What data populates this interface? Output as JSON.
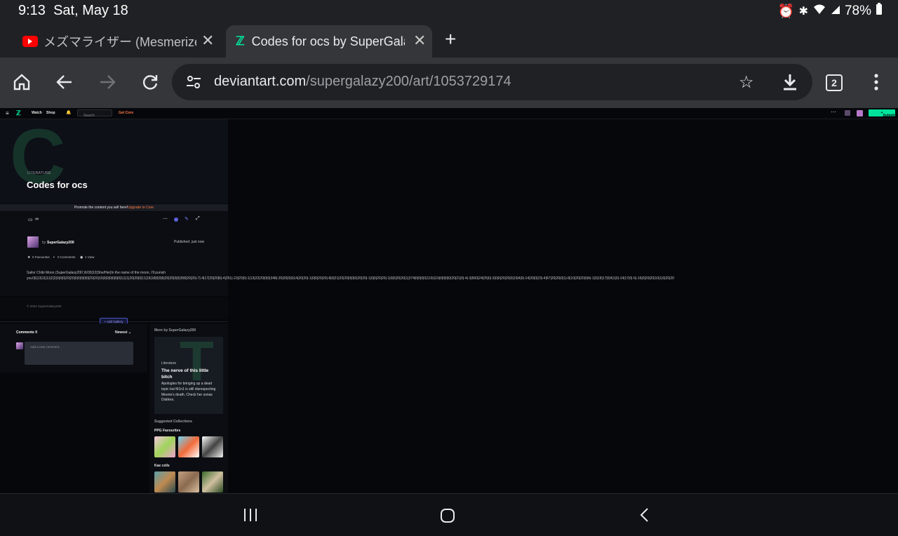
{
  "status_bar": {
    "time": "9:13",
    "date": "Sat, May 18",
    "battery": "78%",
    "icons": [
      "alarm-icon",
      "bluetooth-icon",
      "wifi-icon",
      "signal-icon",
      "battery-icon"
    ]
  },
  "tabs": [
    {
      "title": "メズマライザー (Mesmerizer)",
      "icon": "youtube-icon",
      "active": false
    },
    {
      "title": "Codes for ocs by SuperGalazy",
      "icon": "deviantart-icon",
      "active": true
    }
  ],
  "toolbar": {
    "url_host": "deviantart.com",
    "url_path": "/supergalazy200/art/1053729174",
    "tab_count": "2"
  },
  "colors": {
    "accent_green": "#00e59b",
    "core_orange": "#ff7a45"
  },
  "da": {
    "nav": {
      "watch": "Watch",
      "shop": "Shop",
      "search_placeholder": "Search",
      "get_core": "Get Core",
      "submit": "Submit"
    },
    "hero": {
      "category": "LITERATURE",
      "title": "Codes for ocs"
    },
    "promo": {
      "text": "Promote the content you sell here!",
      "link": "Upgrade to Core"
    },
    "author": {
      "by": "by",
      "name": "SuperGalazy200",
      "published": "Published: just now"
    },
    "stats": {
      "favourites": "0 Favourites",
      "comments": "0 Comments",
      "views": "1 View"
    },
    "body": {
      "line1": "Sailor Chibi Moon (SuperGalazy200 )6/30|12|She/Her|In the name of the moon, I'll punish",
      "line2": "you!|6|13|11|11|2|2|0|0|0|20|20|0|0|0|0|0|20|20|10|0|0|0|0|0|0|1|1|1|20|20|0|11|19|18|0|0|6|20|20|0|0|358|20|20|-7|-4|17|20|20|6|-4|251|-23|20|0|-1|13|22|20|0|0|348|-20|20|0|0|14|20|20|-1|0|0|20|20|-8|0|21|20|20|0|0|0|20|20|-1|0|0|20|20|-1|0|0|20|20|1|374|0|0|0|0|119|119|0|0|0|0|20|21|0|-4|-3|560|24|25|0|-3|0|0|20|20|0|10|4|0|-14|20|0|23|-4|67|20|20|0|1|-8|10|20|20|0|4|-1|0|18|17|0|4|1|0|-14|17|0|-6|-16|0|20|20|10|1|0|20|20"
    },
    "footer": {
      "copyright": "© 2024 SuperGalazy200"
    },
    "add_gallery": "+ Add Gallery",
    "comments": {
      "title": "Comments",
      "count": "0",
      "sort": "Newest",
      "placeholder": "Add a new comment..."
    },
    "more": {
      "title": "More by SuperGalazy200",
      "card": {
        "category": "Literature",
        "title": "The nerve of this little bitch",
        "excerpt": "Apologies for bringing up a dead topic but M1n1 is still disrespecting Meerie's death. Check her sonas Dislikes."
      },
      "suggested_title": "Suggested Collections",
      "collection1": "PPG Favourites",
      "collection2": "Kae cells"
    }
  }
}
